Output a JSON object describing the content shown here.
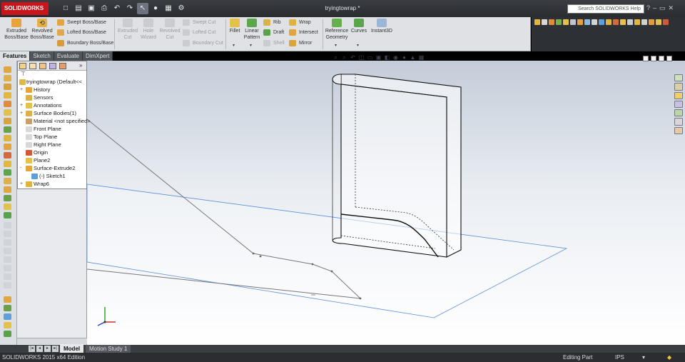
{
  "app": {
    "logo_text": "SOLIDWORKS",
    "document_title": "tryingtowrap *"
  },
  "search": {
    "placeholder": "Search SOLIDWORKS Help"
  },
  "command_manager": {
    "extruded_boss": "Extruded\nBoss/Base",
    "revolved_boss": "Revolved\nBoss/Base",
    "swept_boss": "Swept Boss/Base",
    "lofted_boss": "Lofted Boss/Base",
    "boundary_boss": "Boundary Boss/Base",
    "extruded_cut": "Extruded\nCut",
    "hole_wizard": "Hole\nWizard",
    "revolved_cut": "Revolved\nCut",
    "swept_cut": "Swept Cut",
    "lofted_cut": "Lofted Cut",
    "boundary_cut": "Boundary Cut",
    "fillet": "Fillet",
    "linear_pattern": "Linear\nPattern",
    "rib": "Rib",
    "draft": "Draft",
    "shell": "Shell",
    "wrap": "Wrap",
    "intersect": "Intersect",
    "mirror": "Mirror",
    "reference_geometry": "Reference\nGeometry",
    "curves": "Curves",
    "instant3d": "Instant3D"
  },
  "tabs": [
    "Features",
    "Sketch",
    "Evaluate",
    "DimXpert"
  ],
  "tree": {
    "root": "tryingtowrap  (Default<<",
    "items": [
      {
        "label": "History",
        "icon": "history-icon",
        "expander": "+"
      },
      {
        "label": "Sensors",
        "icon": "sensors-icon",
        "expander": ""
      },
      {
        "label": "Annotations",
        "icon": "annotations-icon",
        "expander": "+"
      },
      {
        "label": "Surface Bodies(1)",
        "icon": "surface-bodies-icon",
        "expander": "+"
      },
      {
        "label": "Material <not specified>",
        "icon": "material-icon",
        "expander": ""
      },
      {
        "label": "Front Plane",
        "icon": "plane-icon",
        "expander": ""
      },
      {
        "label": "Top Plane",
        "icon": "plane-icon",
        "expander": ""
      },
      {
        "label": "Right Plane",
        "icon": "plane-icon",
        "expander": ""
      },
      {
        "label": "Origin",
        "icon": "origin-icon",
        "expander": ""
      },
      {
        "label": "Plane2",
        "icon": "plane-icon",
        "expander": ""
      },
      {
        "label": "Surface-Extrude2",
        "icon": "surface-extrude-icon",
        "expander": "-"
      },
      {
        "label": "(-) Sketch1",
        "icon": "sketch-icon",
        "expander": ""
      },
      {
        "label": "Wrap6",
        "icon": "wrap-feature-icon",
        "expander": "+"
      }
    ]
  },
  "bottom_tabs": {
    "model": "Model",
    "motion_study": "Motion Study 1"
  },
  "status": {
    "edition": "SOLIDWORKS 2015 x64 Edition",
    "mode": "Editing Part",
    "units": "IPS"
  },
  "colors": {
    "logo_red": "#c8151b",
    "title_bar": "#2f3236",
    "ribbon": "#dfe1e4",
    "plane_edge": "#5b8fd6"
  }
}
